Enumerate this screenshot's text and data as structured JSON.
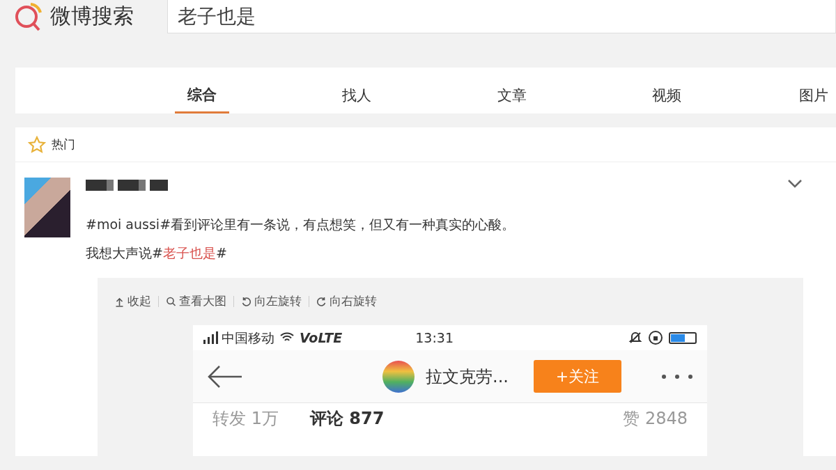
{
  "header": {
    "logo_text": "微博搜索",
    "search_value": "老子也是"
  },
  "tabs": [
    {
      "label": "综合",
      "selected": true
    },
    {
      "label": "找人",
      "selected": false
    },
    {
      "label": "文章",
      "selected": false
    },
    {
      "label": "视频",
      "selected": false
    },
    {
      "label": "图片",
      "selected": false
    }
  ],
  "section": {
    "title": "热门"
  },
  "post": {
    "text": "#moi aussi#看到评论里有一条说，有点想笑，但又有一种真实的心酸。",
    "line2_prefix": "我想大声说#",
    "line2_link": "老子也是",
    "line2_suffix": "#",
    "image_toolbar": [
      {
        "kind": "collapse",
        "label": "收起"
      },
      {
        "kind": "zoom",
        "label": "查看大图"
      },
      {
        "kind": "rotate-left",
        "label": "向左旋转"
      },
      {
        "kind": "rotate-right",
        "label": "向右旋转"
      }
    ],
    "screenshot": {
      "carrier": "中国移动",
      "network": "VoLTE",
      "time": "13:31",
      "level": 0.6,
      "account": "拉文克劳...",
      "follow_button": "+关注",
      "stats": [
        {
          "label": "转发",
          "count": "1万",
          "selected": false
        },
        {
          "label": "评论",
          "count": "877",
          "selected": true
        },
        {
          "label": "赞",
          "count": "2848",
          "selected": false
        }
      ]
    }
  }
}
